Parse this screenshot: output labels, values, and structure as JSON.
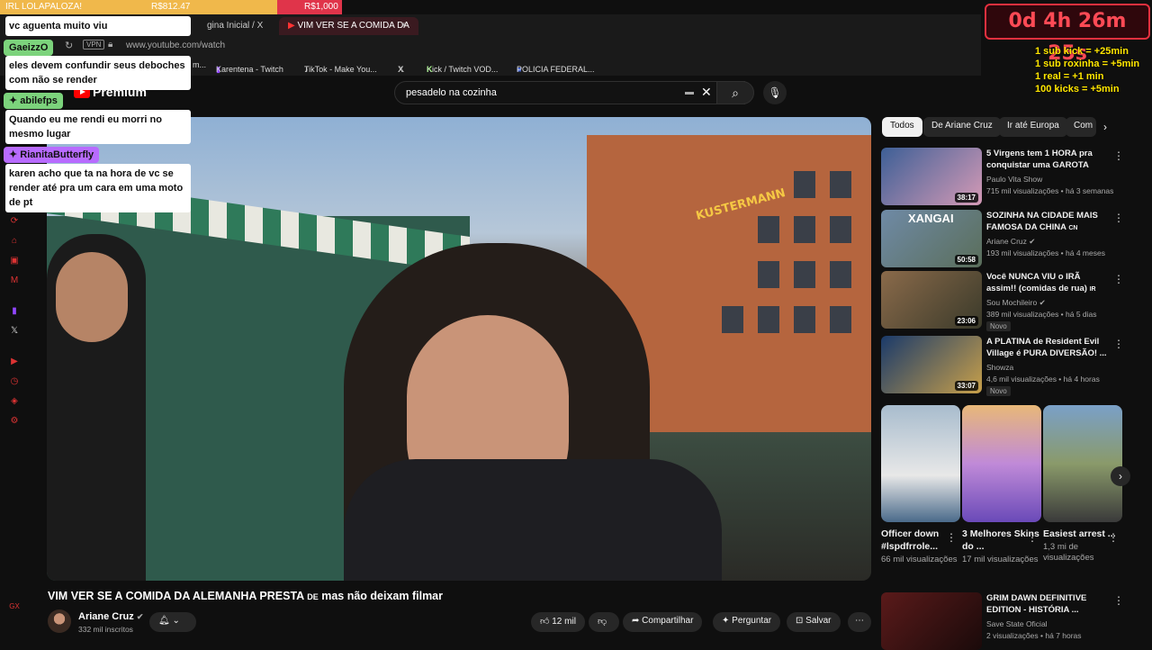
{
  "goal_bar": {
    "label": "IRL LOLAPALOZA!",
    "current": "R$812.47",
    "target": "R$1,000",
    "progress": 0.812
  },
  "browser": {
    "tabs": [
      {
        "label": "gina Inicial / X"
      },
      {
        "label": "VIM VER SE A COMIDA DA"
      }
    ],
    "new_tab": "+",
    "vpn": "VPN",
    "url": "www.youtube.com/watch",
    "bookmarks": [
      "m...",
      "Karentena - Twitch",
      "TikTok - Make You...",
      "X",
      "Kick / Twitch VOD...",
      "POLICIA FEDERAL..."
    ]
  },
  "chat": [
    {
      "text": "vc aguenta muito viu"
    },
    {
      "user": "GaeizzO",
      "user_color": "#7cd37c"
    },
    {
      "text": "eles devem confundir seus deboches com não se render"
    },
    {
      "user": "abilefps",
      "user_color": "#7cd37c"
    },
    {
      "text": "Quando eu me rendi eu morri no mesmo lugar"
    },
    {
      "user": "RianitaButterfly",
      "user_color": "#b86bff"
    },
    {
      "text": "karen acho que ta na hora de vc se render até pra um cara em uma moto de pt"
    }
  ],
  "timer": "0d 4h 26m 25s",
  "stream_rules": [
    "1 sub kick = +25min",
    "1 sub roxinha = +5min",
    "1 real = +1 min",
    "100 kicks = +5min"
  ],
  "youtube": {
    "logo": "Premium",
    "search_value": "pesadelo na cozinha",
    "video_title": "VIM VER SE A COMIDA DA ALEMANHA PRESTA",
    "video_title_suffix": "DE",
    "video_title_rest": "mas não deixam filmar",
    "sign_text": "KUSTERMANN",
    "channel": {
      "name": "Ariane Cruz",
      "subs": "332 mil inscritos"
    },
    "actions": {
      "likes": "12 mil",
      "share": "Compartilhar",
      "ask": "Perguntar",
      "save": "Salvar",
      "more": "⋯"
    },
    "chips": [
      "Todos",
      "De Ariane Cruz",
      "Ir até Europa",
      "Com"
    ],
    "recommendations": [
      {
        "title": "5 Virgens tem 1 HORA pra conquistar uma GAROTA",
        "channel": "Paulo Vita Show",
        "meta": "715 mil visualizações • há 3 semanas",
        "duration": "38:17",
        "thumb_color": "#4a6a9a"
      },
      {
        "title": "SOZINHA NA CIDADE MAIS FAMOSA DA CHINA",
        "title_tag": "CN",
        "channel": "Ariane Cruz",
        "meta": "193 mil visualizações • há 4 meses",
        "duration": "50:58",
        "thumb_text": "XANGAI",
        "thumb_color": "#5a6e5a"
      },
      {
        "title": "Você NUNCA VIU o IRÃ assim!! (comidas de rua)",
        "title_tag": "IR",
        "channel": "Sou Mochileiro",
        "meta": "389 mil visualizações • há 5 dias",
        "duration": "23:06",
        "badge": "Novo",
        "thumb_color": "#7a5a3a"
      },
      {
        "title": "A PLATINA de Resident Evil Village é PURA DIVERSÃO! ...",
        "channel": "Showza",
        "meta": "4,6 mil visualizações • há 4 horas",
        "duration": "33:07",
        "badge": "Novo",
        "thumb_color": "#1a3a6a"
      },
      {
        "title": "GRIM DAWN DEFINITIVE EDITION - HISTÓRIA ...",
        "channel": "Save State Oficial",
        "meta": "2 visualizações • há 7 horas",
        "thumb_color": "#5a1a1a"
      }
    ],
    "shorts": [
      {
        "title": "Officer down #lspdfrrole...",
        "views": "66 mil visualizações",
        "color": "#8aa0b8"
      },
      {
        "title": "3 Melhores Skins do ...",
        "views": "17 mil visualizações",
        "color": "#c08ad8"
      },
      {
        "title": "Easiest arrest ...",
        "views": "1,3 mi de visualizações",
        "color": "#6a8a5a"
      }
    ]
  }
}
